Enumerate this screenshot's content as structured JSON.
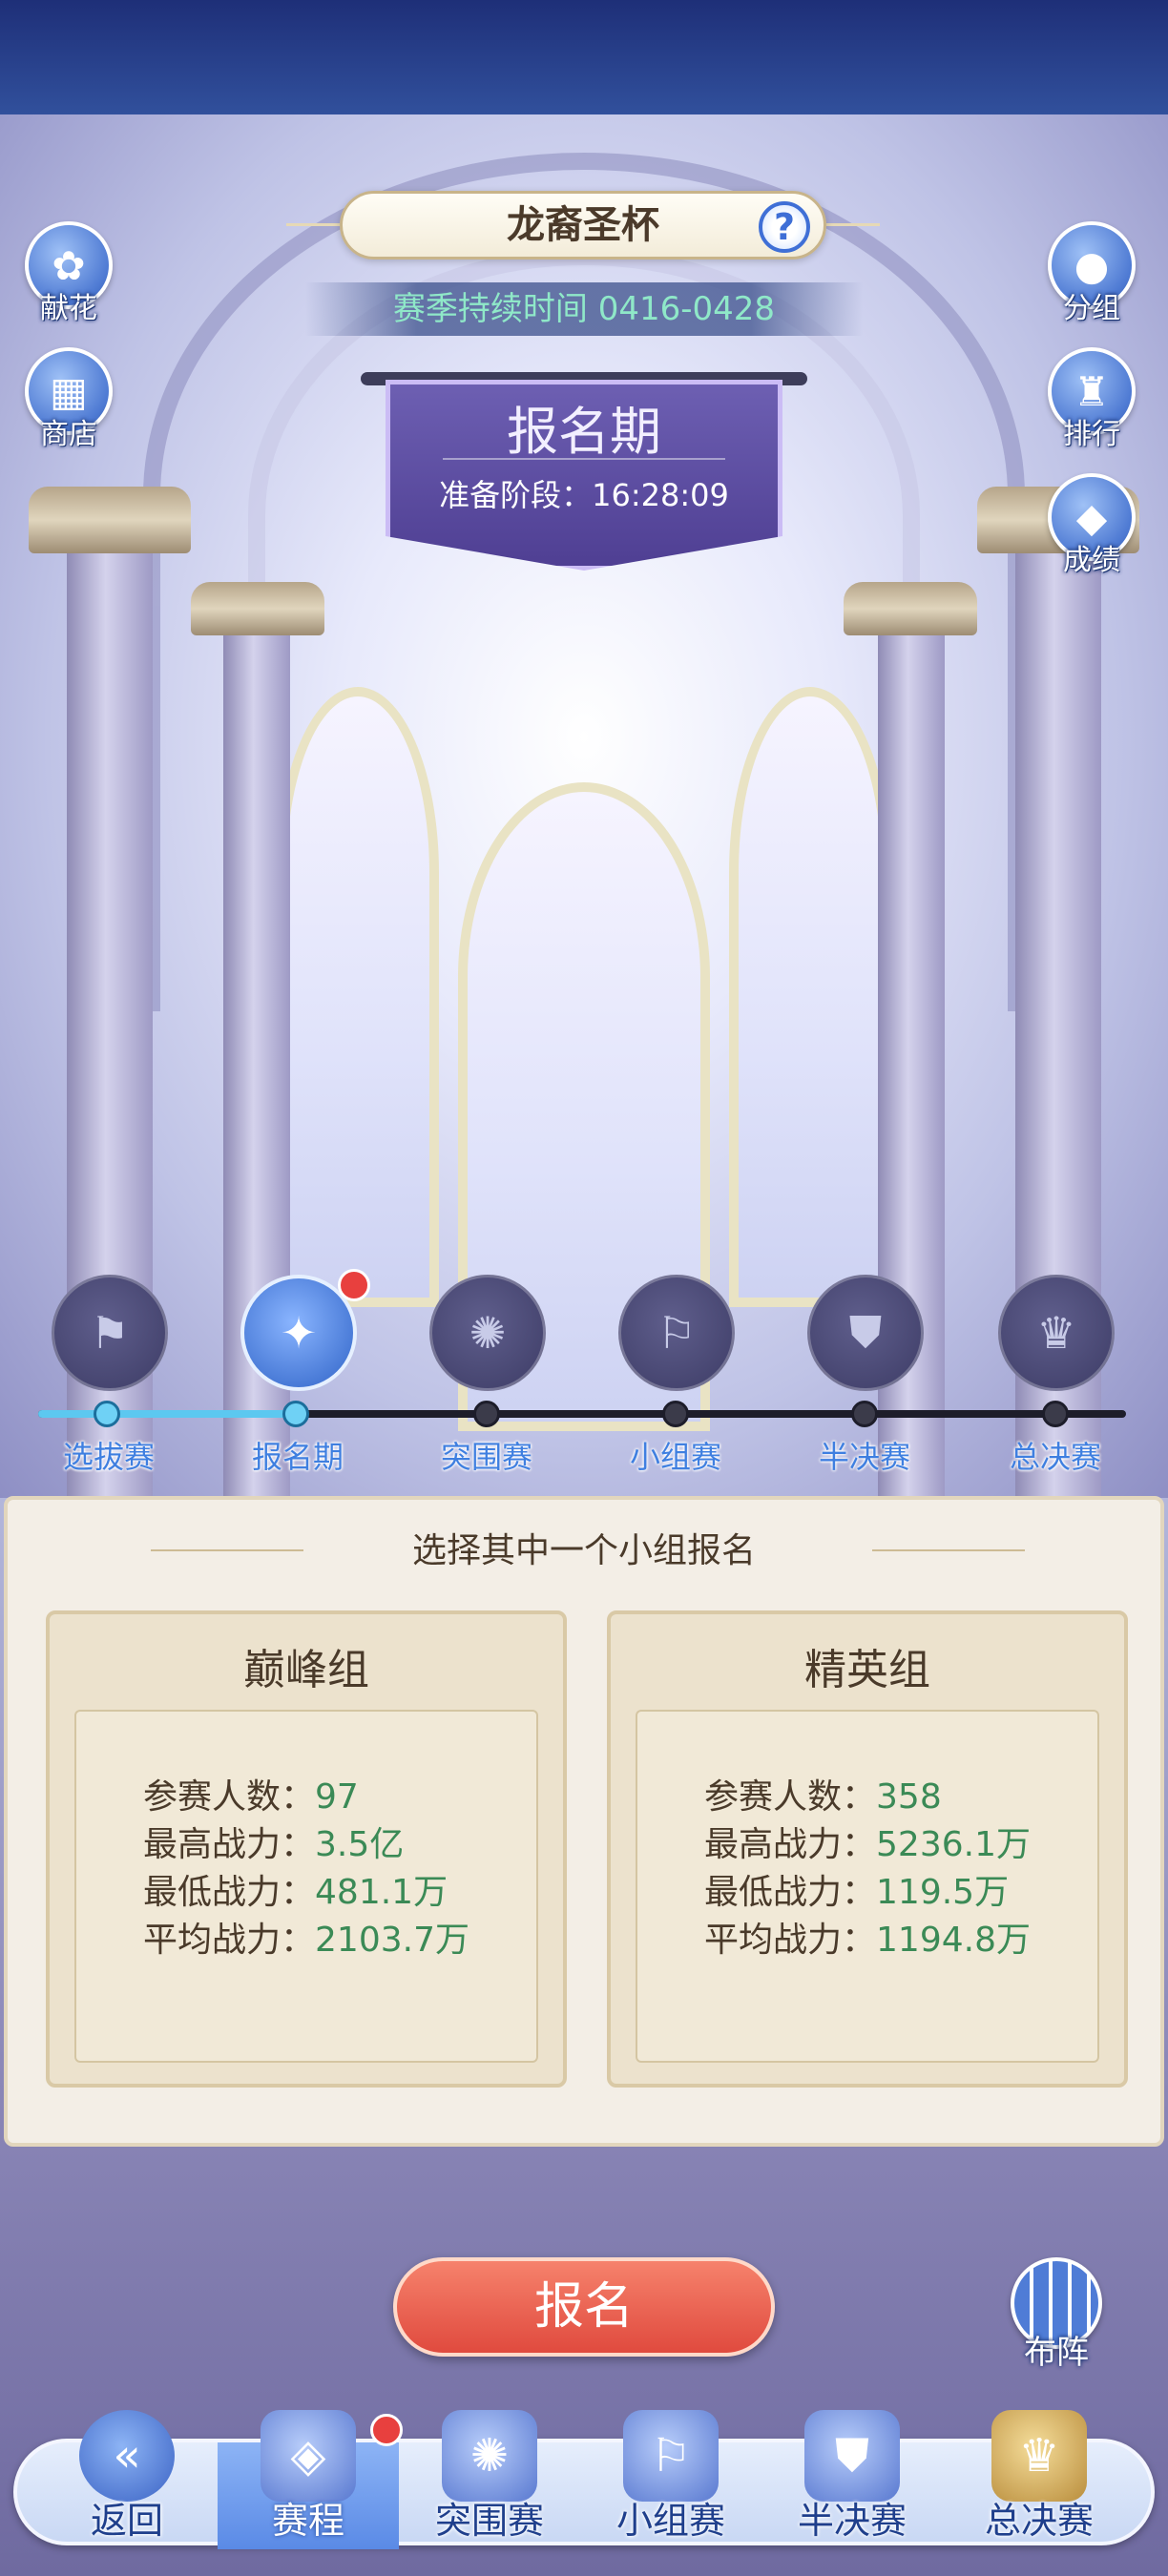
{
  "header": {
    "title": "龙裔圣杯",
    "help_icon": "?",
    "season_text": "赛季持续时间 0416-0428"
  },
  "left_buttons": [
    {
      "label": "献花",
      "icon": "flower-icon"
    },
    {
      "label": "商店",
      "icon": "shop-icon"
    }
  ],
  "right_buttons": [
    {
      "label": "分组",
      "icon": "group-icon"
    },
    {
      "label": "排行",
      "icon": "ranking-icon"
    },
    {
      "label": "成绩",
      "icon": "scorecard-icon"
    }
  ],
  "phase": {
    "title": "报名期",
    "countdown": "准备阶段：16:28:09"
  },
  "stages": [
    {
      "label": "选拔赛",
      "icon": "selection-flag-icon",
      "done": true
    },
    {
      "label": "报名期",
      "icon": "registration-book-icon",
      "done": true,
      "active": true,
      "badge": true
    },
    {
      "label": "突围赛",
      "icon": "breakout-banner-icon",
      "done": false
    },
    {
      "label": "小组赛",
      "icon": "group-flag-icon",
      "done": false
    },
    {
      "label": "半决赛",
      "icon": "semifinal-shield-icon",
      "done": false
    },
    {
      "label": "总决赛",
      "icon": "final-trophy-icon",
      "done": false
    }
  ],
  "panel": {
    "title": "选择其中一个小组报名",
    "groups": [
      {
        "name": "巅峰组",
        "stats": [
          {
            "label": "参赛人数：",
            "value": "97"
          },
          {
            "label": "最高战力：",
            "value": "3.5亿"
          },
          {
            "label": "最低战力：",
            "value": "481.1万"
          },
          {
            "label": "平均战力：",
            "value": "2103.7万"
          }
        ]
      },
      {
        "name": "精英组",
        "stats": [
          {
            "label": "参赛人数：",
            "value": "358"
          },
          {
            "label": "最高战力：",
            "value": "5236.1万"
          },
          {
            "label": "最低战力：",
            "value": "119.5万"
          },
          {
            "label": "平均战力：",
            "value": "1194.8万"
          }
        ]
      }
    ]
  },
  "register_button": "报名",
  "layout_button": "布阵",
  "bottom_nav": [
    {
      "label": "返回",
      "icon": "back-icon"
    },
    {
      "label": "赛程",
      "icon": "schedule-icon",
      "active": true,
      "badge": true
    },
    {
      "label": "突围赛",
      "icon": "breakout-icon"
    },
    {
      "label": "小组赛",
      "icon": "group-stage-icon"
    },
    {
      "label": "半决赛",
      "icon": "semifinal-icon"
    },
    {
      "label": "总决赛",
      "icon": "final-icon"
    }
  ],
  "colors": {
    "accent_blue": "#3f7fe0",
    "stat_value_green": "#3b8a56",
    "register_red": "#e04a3e",
    "phase_purple": "#5a4aa0"
  }
}
